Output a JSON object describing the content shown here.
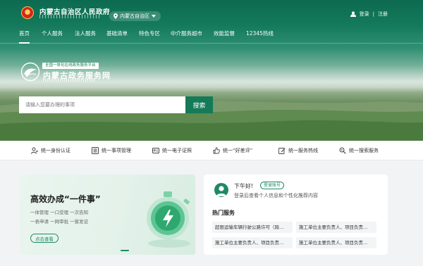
{
  "header": {
    "site_title": "内蒙古自治区人民政府",
    "region": "内蒙古自治区",
    "login": "登录",
    "separator": "|",
    "register": "注册"
  },
  "nav": {
    "items": [
      "首页",
      "个人服务",
      "法人服务",
      "基础清单",
      "特色专区",
      "中介服务超市",
      "效能监督",
      "12345热线"
    ],
    "active_index": 0
  },
  "portal": {
    "platform_tag": "全国一体化在线政务服务平台",
    "name": "内蒙古政务服务网"
  },
  "search": {
    "placeholder": "请输入您要办理的事项",
    "button": "搜索"
  },
  "quick_links": [
    {
      "label": "统一身份认证",
      "icon": "user-id-icon"
    },
    {
      "label": "统一事项管理",
      "icon": "list-icon"
    },
    {
      "label": "统一电子证照",
      "icon": "id-card-icon"
    },
    {
      "label": "统一“好差评”",
      "icon": "thumbs-up-icon"
    },
    {
      "label": "统一服务热线",
      "icon": "edit-icon"
    },
    {
      "label": "统一搜索服务",
      "icon": "search-list-icon"
    }
  ],
  "promo": {
    "title": "高效办成“一件事”",
    "lines": [
      "一体管理 一口受理 一次告知",
      "一表申请 一网审批 一窗发证"
    ],
    "button": "点击查看"
  },
  "service_panel": {
    "greeting": "下午好!",
    "login_link": "登录账号",
    "subtitle": "登录后查看个人信息和个性化推荐内容",
    "hot_title": "热门服务",
    "hot_items": [
      "超限运输车辆行驶公路许可（跨…",
      "施工单位主要负责人、项目负责…",
      "施工单位主要负责人、项目负责…",
      "施工单位主要负责人、项目负责…"
    ]
  },
  "colors": {
    "brand_green": "#157a58",
    "accent_green": "#1f8a62"
  }
}
